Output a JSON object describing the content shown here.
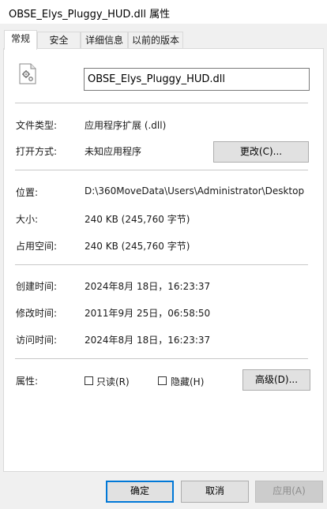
{
  "window": {
    "title": "OBSE_Elys_Pluggy_HUD.dll 属性"
  },
  "tabs": [
    {
      "label": "常规",
      "active": true
    },
    {
      "label": "安全"
    },
    {
      "label": "详细信息"
    },
    {
      "label": "以前的版本"
    }
  ],
  "file": {
    "name": "OBSE_Elys_Pluggy_HUD.dll",
    "icon": "dll-gear-file-icon"
  },
  "general": {
    "type_label": "文件类型:",
    "type_value": "应用程序扩展 (.dll)",
    "opens_label": "打开方式:",
    "opens_value": "未知应用程序",
    "change_btn": "更改(C)...",
    "location_label": "位置:",
    "location_value": "D:\\360MoveData\\Users\\Administrator\\Desktop",
    "size_label": "大小:",
    "size_value": "240 KB (245,760 字节)",
    "disk_label": "占用空间:",
    "disk_value": "240 KB (245,760 字节)",
    "created_label": "创建时间:",
    "created_value": "2024年8月 18日，16:23:37",
    "modified_label": "修改时间:",
    "modified_value": "2011年9月 25日，06:58:50",
    "accessed_label": "访问时间:",
    "accessed_value": "2024年8月 18日，16:23:37",
    "attr_label": "属性:",
    "readonly_label": "只读(R)",
    "readonly_checked": false,
    "hidden_label": "隐藏(H)",
    "hidden_checked": false,
    "advanced_btn": "高级(D)..."
  },
  "footer": {
    "ok": "确定",
    "cancel": "取消",
    "apply": "应用(A)"
  },
  "colors": {
    "focus_border": "#0078d7",
    "panel_bg": "#ffffff",
    "window_bg": "#f0f0f0"
  }
}
